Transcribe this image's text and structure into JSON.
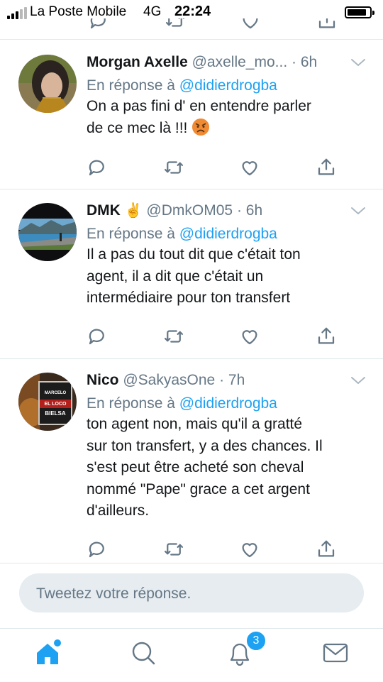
{
  "status_bar": {
    "carrier": "La Poste Mobile",
    "network": "4G",
    "time": "22:24",
    "signal_bars_filled": 3,
    "signal_bars_total": 5
  },
  "tweets": [
    {
      "display_name": "Morgan Axelle",
      "handle": "@axelle_mo...",
      "time": "· 6h",
      "reply_prefix": "En réponse à",
      "reply_to": "@didierdrogba",
      "text_lines": [
        "On a pas fini d' en entendre parler",
        "de ce mec là !!!"
      ],
      "emoji": "angry-face"
    },
    {
      "display_name": "DMK",
      "name_emoji": "✌",
      "handle": "@DmkOM05",
      "time": "· 6h",
      "reply_prefix": "En réponse à",
      "reply_to": "@didierdrogba",
      "text_lines": [
        "Il a pas du tout dit que c'était ton",
        "agent, il a dit que c'était un",
        "intermédiaire pour ton transfert"
      ]
    },
    {
      "display_name": "Nico",
      "handle": "@SakyasOne",
      "time": "· 7h",
      "reply_prefix": "En réponse à",
      "reply_to": "@didierdrogba",
      "text_lines": [
        "ton agent non, mais qu'il a gratté",
        "sur ton transfert, y a des chances. Il",
        "s'est peut être acheté son cheval",
        "nommé \"Pape\" grace a cet argent",
        "d'ailleurs."
      ],
      "avatar_text": [
        "MARCELO",
        "EL LOCO",
        "BIELSA"
      ]
    }
  ],
  "compose": {
    "placeholder": "Tweetez votre réponse."
  },
  "nav": {
    "items": [
      "home-icon",
      "search-icon",
      "notifications-icon",
      "messages-icon"
    ],
    "notifications_badge": "3",
    "accent": "#1da1f2",
    "icon_color": "#657786"
  }
}
